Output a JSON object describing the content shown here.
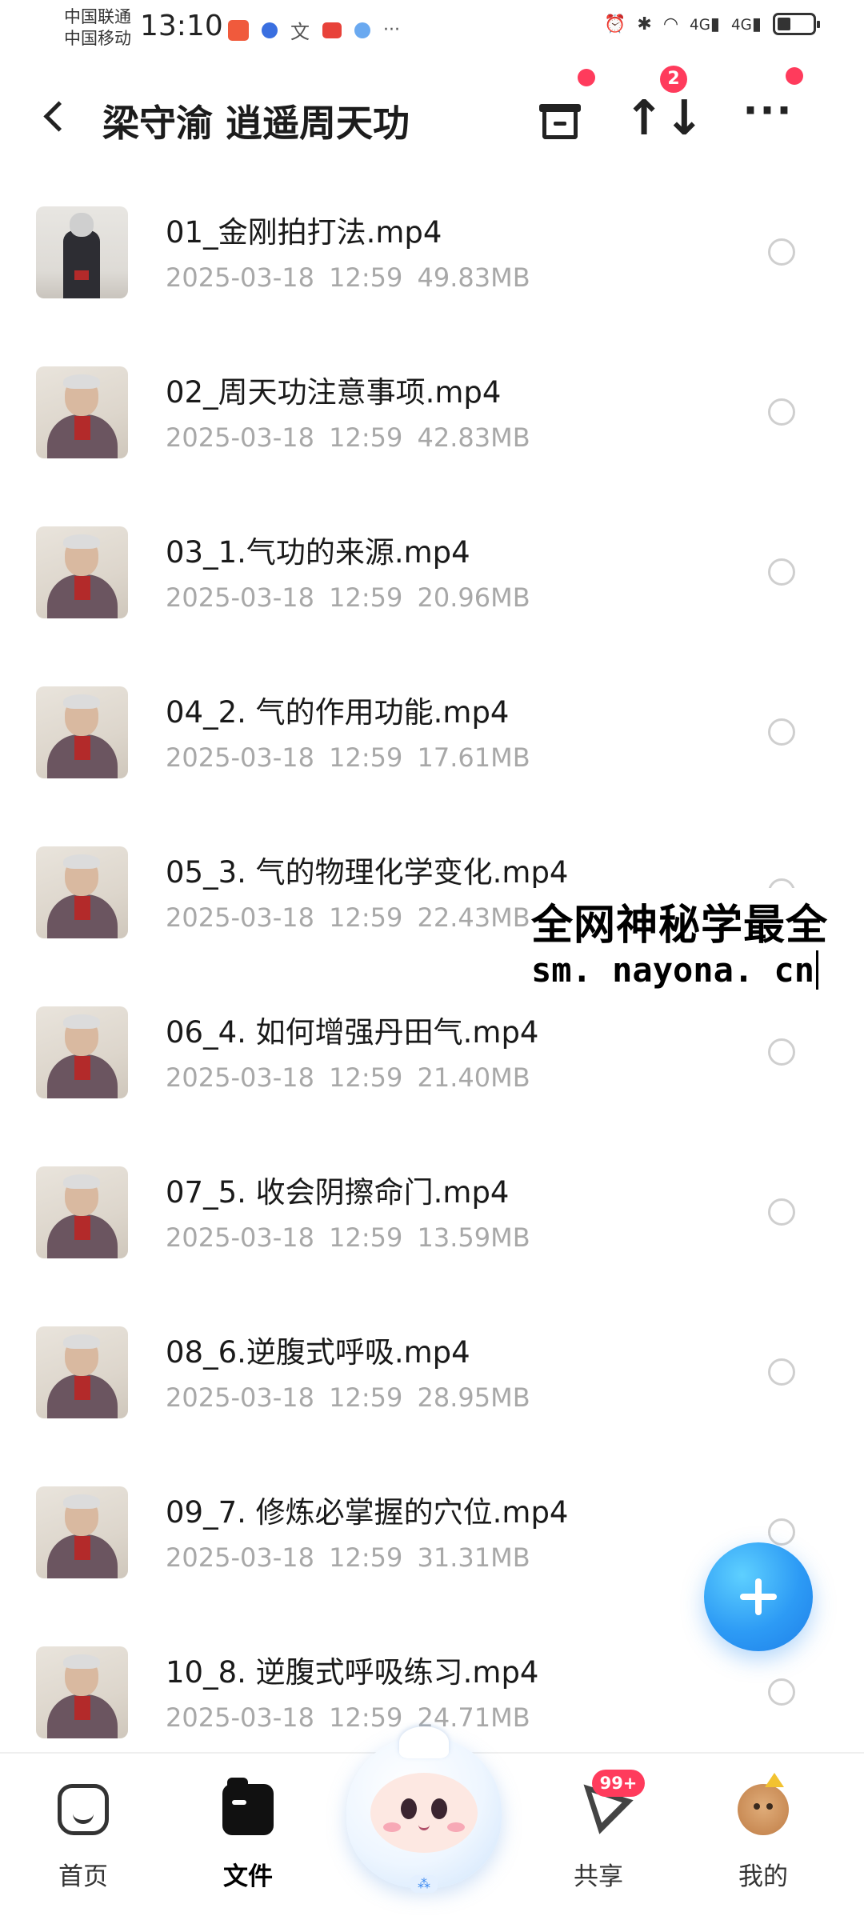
{
  "status_bar": {
    "carrier_1": "中国联通",
    "carrier_2": "中国移动",
    "time": "13:10",
    "network_1": "4G",
    "network_2": "4G"
  },
  "header": {
    "title": "梁守渝 逍遥周天功",
    "sort_badge": "2",
    "sort_icon": "↑↓",
    "more_icon": "···"
  },
  "files": [
    {
      "name": "01_金刚拍打法.mp4",
      "date": "2025-03-18",
      "time": "12:59",
      "size": "49.83MB"
    },
    {
      "name": "02_周天功注意事项.mp4",
      "date": "2025-03-18",
      "time": "12:59",
      "size": "42.83MB"
    },
    {
      "name": "03_1.气功的来源.mp4",
      "date": "2025-03-18",
      "time": "12:59",
      "size": "20.96MB"
    },
    {
      "name": "04_2. 气的作用功能.mp4",
      "date": "2025-03-18",
      "time": "12:59",
      "size": "17.61MB"
    },
    {
      "name": "05_3. 气的物理化学变化.mp4",
      "date": "2025-03-18",
      "time": "12:59",
      "size": "22.43MB"
    },
    {
      "name": "06_4. 如何增强丹田气.mp4",
      "date": "2025-03-18",
      "time": "12:59",
      "size": "21.40MB"
    },
    {
      "name": "07_5. 收会阴擦命门.mp4",
      "date": "2025-03-18",
      "time": "12:59",
      "size": "13.59MB"
    },
    {
      "name": "08_6.逆腹式呼吸.mp4",
      "date": "2025-03-18",
      "time": "12:59",
      "size": "28.95MB"
    },
    {
      "name": "09_7. 修炼必掌握的穴位.mp4",
      "date": "2025-03-18",
      "time": "12:59",
      "size": "31.31MB"
    },
    {
      "name": "10_8. 逆腹式呼吸练习.mp4",
      "date": "2025-03-18",
      "time": "12:59",
      "size": "24.71MB"
    }
  ],
  "watermark": {
    "line1": "全网神秘学最全",
    "line2": "sm. nayona. cn"
  },
  "bottom_nav": {
    "home": "首页",
    "files": "文件",
    "share": "共享",
    "share_badge": "99+",
    "mine": "我的"
  },
  "colors": {
    "accent_blue": "#2d9bf5",
    "badge_red": "#ff3b5c",
    "meta_gray": "#a8a8a8"
  }
}
